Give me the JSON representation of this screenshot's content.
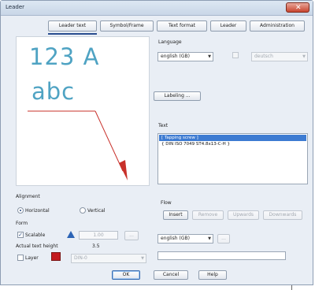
{
  "window": {
    "title": "Leader",
    "close_glyph": "✕"
  },
  "tabs": [
    {
      "label": "Leader text"
    },
    {
      "label": "Symbol/Frame"
    },
    {
      "label": "Text format"
    },
    {
      "label": "Leader"
    },
    {
      "label": "Administration"
    }
  ],
  "preview": {
    "line1": "123 A",
    "line2": "abc",
    "leader_color": "#c8302a",
    "text_color": "#4fa3c3"
  },
  "language": {
    "label": "Language",
    "primary_value": "english (GB)",
    "secondary_value": "deutsch"
  },
  "labeling_button": "Labeling ...",
  "text_section": {
    "label": "Text",
    "items": [
      {
        "text": "[ Tapping screw ]",
        "selected": true
      },
      {
        "text": "{ DIN ISO 7049 ST4.8x13-C-H }",
        "selected": false
      }
    ]
  },
  "flow": {
    "label": "Flow",
    "buttons": [
      "Insert",
      "Remove",
      "Upwards",
      "Downwards"
    ]
  },
  "flow_language": {
    "value": "english (GB)",
    "more_button": "..."
  },
  "alignment": {
    "label": "Alignment",
    "options": [
      {
        "label": "Horizontal",
        "selected": true
      },
      {
        "label": "Vertical",
        "selected": false
      }
    ]
  },
  "form": {
    "label": "Form",
    "scalable_label": "Scalable",
    "scale_value": "1.00",
    "scale_more": "...",
    "actual_height_label": "Actual text height",
    "actual_height_value": "3.5",
    "layer_label": "Layer",
    "layer_value": "DIN-0",
    "layer_color": "#c31a1f"
  },
  "footer": {
    "ok": "OK",
    "cancel": "Cancel",
    "help": "Help"
  }
}
